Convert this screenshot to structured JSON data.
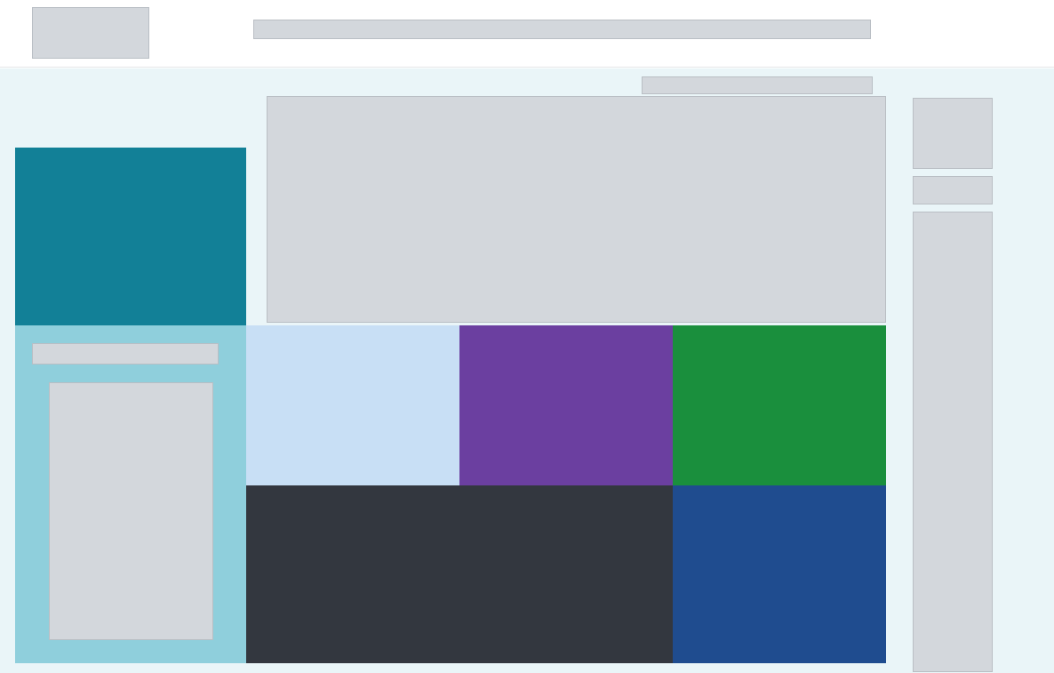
{
  "header": {},
  "hero": {},
  "sidebar": {},
  "tiles": {},
  "notice": {},
  "links": {}
}
